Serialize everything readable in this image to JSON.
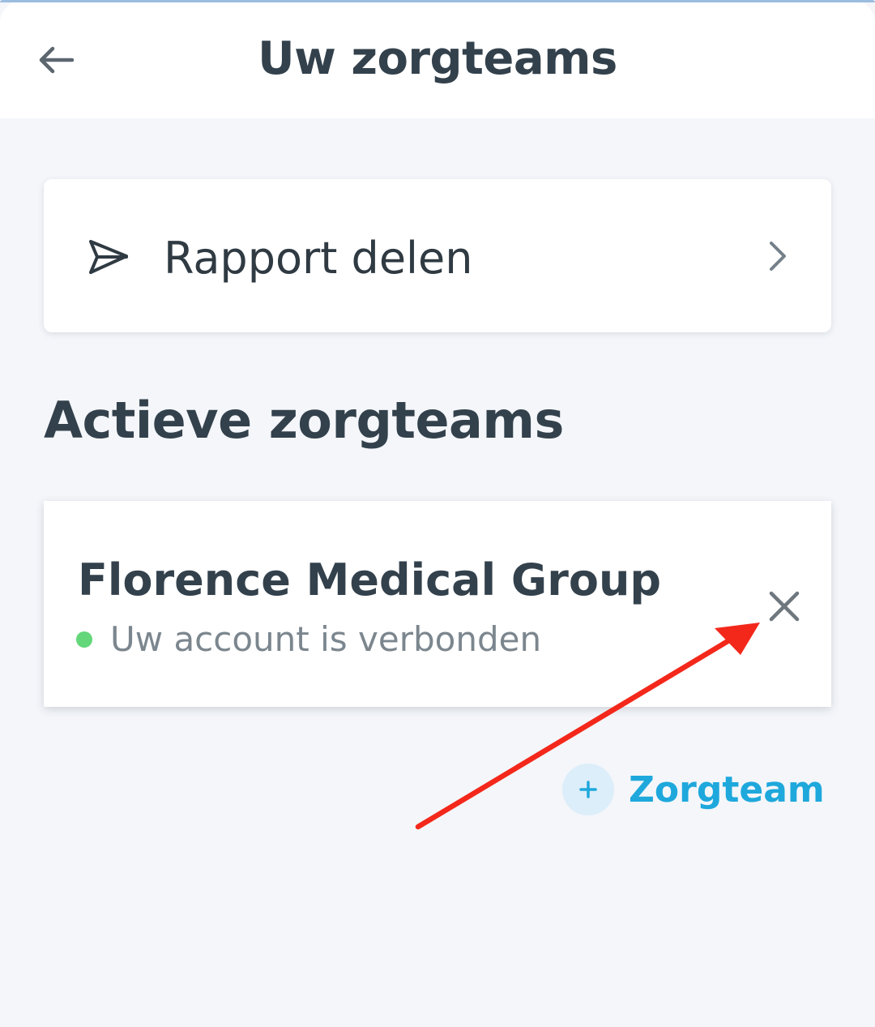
{
  "header": {
    "title": "Uw zorgteams",
    "back_icon": "arrow-left-icon"
  },
  "share": {
    "label": "Rapport delen",
    "icon": "send-icon",
    "chevron_icon": "chevron-right-icon"
  },
  "section": {
    "heading": "Actieve zorgteams"
  },
  "teams": [
    {
      "name": "Florence Medical Group",
      "status": "Uw account is verbonden",
      "status_color": "#63d77a",
      "remove_icon": "close-icon"
    }
  ],
  "add_team": {
    "label": "Zorgteam",
    "icon": "plus-icon"
  },
  "annotation": {
    "type": "arrow",
    "color": "#f3281b",
    "points_to": "close-icon"
  },
  "colors": {
    "background": "#f4f6fa",
    "text": "#33414c",
    "accent": "#1ea8dc"
  }
}
